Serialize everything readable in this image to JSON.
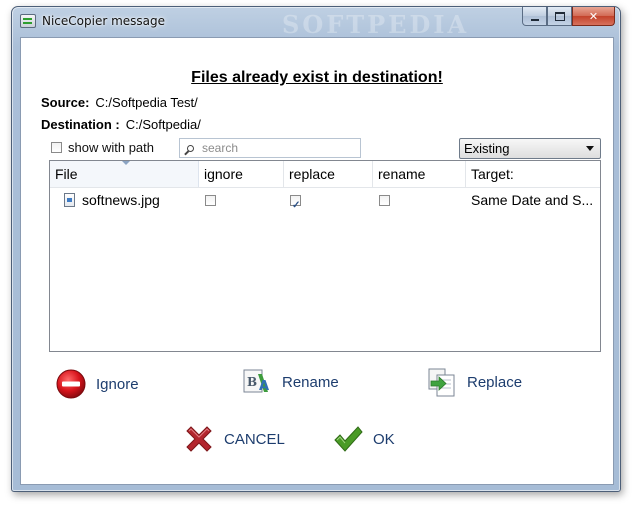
{
  "window": {
    "title": "NiceCopier message",
    "watermark": "SOFTPEDIA"
  },
  "dialog": {
    "heading": "Files already exist in destination!",
    "source_label": "Source:",
    "source_value": "C:/Softpedia Test/",
    "destination_label": "Destination :",
    "destination_value": "C:/Softpedia/"
  },
  "toolbar": {
    "show_with_path_label": "show with path",
    "show_with_path_checked": false,
    "search_placeholder": "search",
    "filter_value": "Existing"
  },
  "table": {
    "columns": [
      "File",
      "ignore",
      "replace",
      "rename",
      "Target:"
    ],
    "rows": [
      {
        "file": "softnews.jpg",
        "ignore": false,
        "replace": true,
        "rename": false,
        "target": "Same Date and S..."
      }
    ]
  },
  "actions": {
    "ignore_label": "Ignore",
    "rename_label": "Rename",
    "replace_label": "Replace",
    "cancel_label": "CANCEL",
    "ok_label": "OK"
  },
  "colors": {
    "ignore_icon": "#d8141c",
    "cancel_icon": "#b3262e",
    "ok_icon": "#4a9b26",
    "action_text": "#1d3d6e"
  },
  "icons": {
    "ignore": "no-entry-icon",
    "rename": "rename-document-icon",
    "replace": "replace-document-icon",
    "cancel": "red-x-icon",
    "ok": "green-checkmark-icon"
  }
}
